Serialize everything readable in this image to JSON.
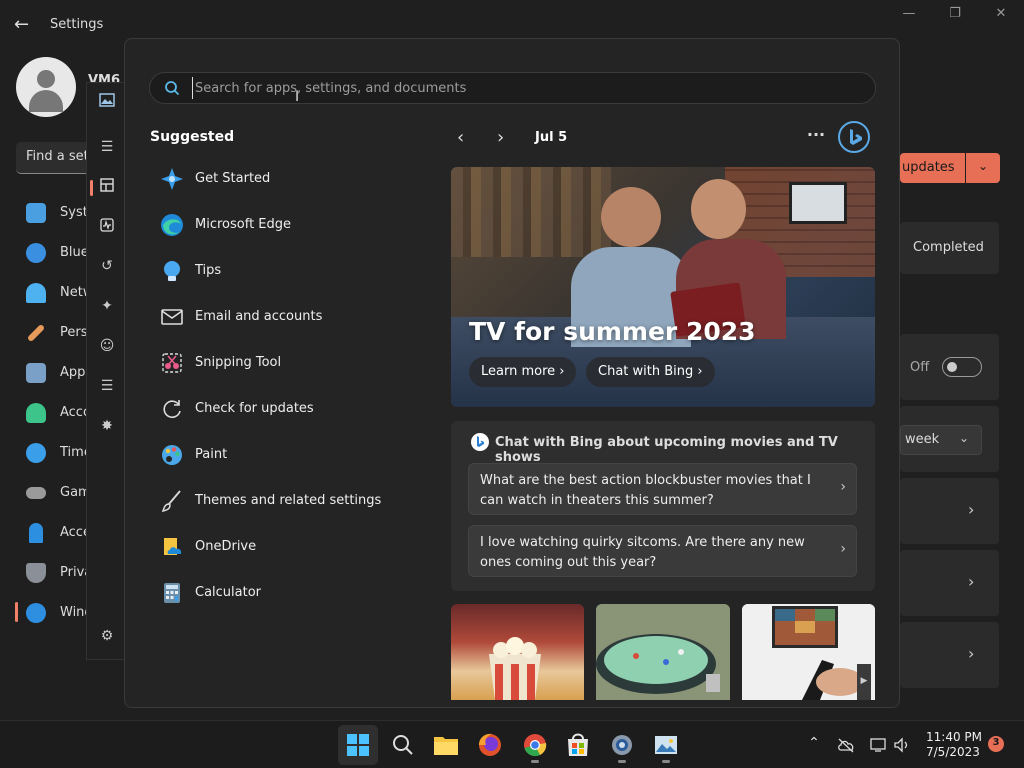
{
  "settings": {
    "title": "Settings",
    "user_name": "VM6",
    "find_placeholder": "Find a setting",
    "nav": [
      {
        "label": "System",
        "color": "#4a9fe0"
      },
      {
        "label": "Bluetooth & devices",
        "color": "#3a8fe0"
      },
      {
        "label": "Network & internet",
        "color": "#4fb2f0"
      },
      {
        "label": "Personalization",
        "color": "#e69a5a"
      },
      {
        "label": "Apps",
        "color": "#7aa0c8"
      },
      {
        "label": "Accounts",
        "color": "#3cc48a"
      },
      {
        "label": "Time & language",
        "color": "#3a9ee8"
      },
      {
        "label": "Gaming",
        "color": "#9a9a9a"
      },
      {
        "label": "Accessibility",
        "color": "#2d8fe0"
      },
      {
        "label": "Privacy & security",
        "color": "#8a8f98"
      },
      {
        "label": "Windows Update",
        "color": "#2e8fe0"
      }
    ],
    "updates_label": "updates",
    "completed_label": "Completed",
    "off_label": "Off",
    "week_label": "week"
  },
  "flyout": {
    "search_placeholder": "Search for apps, settings, and documents",
    "suggested_title": "Suggested",
    "suggested": [
      {
        "label": "Get Started",
        "icon": "get-started-icon",
        "color": "#3a9ee8"
      },
      {
        "label": "Microsoft Edge",
        "icon": "edge-icon",
        "color": "#2fb5a8"
      },
      {
        "label": "Tips",
        "icon": "tips-icon",
        "color": "#4aa8f0"
      },
      {
        "label": "Email and accounts",
        "icon": "mail-icon",
        "color": "#dddddd"
      },
      {
        "label": "Snipping Tool",
        "icon": "snipping-tool-icon",
        "color": "#e85a8a"
      },
      {
        "label": "Check for updates",
        "icon": "refresh-icon",
        "color": "#dddddd"
      },
      {
        "label": "Paint",
        "icon": "paint-icon",
        "color": "#4aa8e8"
      },
      {
        "label": "Themes and related settings",
        "icon": "brush-icon",
        "color": "#dddddd"
      },
      {
        "label": "OneDrive",
        "icon": "onedrive-icon",
        "color": "#f5c542"
      },
      {
        "label": "Calculator",
        "icon": "calculator-icon",
        "color": "#6a8faa"
      }
    ],
    "date": "Jul 5",
    "hero": {
      "title": "TV for summer 2023",
      "learn_more": "Learn more",
      "chat_bing": "Chat with Bing"
    },
    "bing_card": {
      "title": "Chat with Bing about upcoming movies and TV shows",
      "prompts": [
        "What are the best action blockbuster movies that I can watch in theaters this summer?",
        "I love watching quirky sitcoms. Are there any new ones coming out this year?"
      ]
    }
  },
  "taskbar": {
    "time": "11:40 PM",
    "date": "7/5/2023",
    "notifications": "3"
  }
}
